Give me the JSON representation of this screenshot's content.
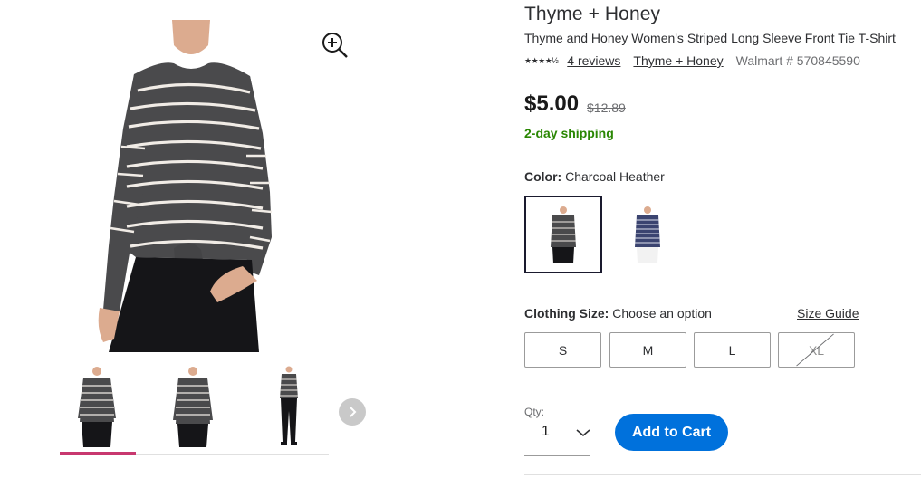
{
  "gallery": {
    "main_image_alt": "",
    "zoom_icon": "zoom-in-icon",
    "next_icon": "chevron-right-icon",
    "selected_thumbnail": 0,
    "thumbnail_count": 3
  },
  "product": {
    "brand": "Thyme + Honey",
    "title": "Thyme and Honey Women's Striped Long Sleeve Front Tie T-Shirt",
    "stars_display": "★★★★½",
    "rating": 4.5,
    "reviews_link": "4 reviews",
    "brand_link": "Thyme + Honey",
    "walmart_number": "Walmart # 570845590",
    "price": "$5.00",
    "was_price": "$12.89",
    "shipping": "2-day shipping"
  },
  "color": {
    "label": "Color:",
    "selected_value": "Charcoal Heather",
    "swatches": [
      "charcoal-heather",
      "navy-stripe"
    ]
  },
  "size": {
    "label": "Clothing Size:",
    "prompt": "Choose an option",
    "guide_link": "Size Guide",
    "options": [
      "S",
      "M",
      "L",
      "XL"
    ],
    "unavailable": [
      "XL"
    ]
  },
  "cart": {
    "qty_label": "Qty:",
    "qty_value": "1",
    "add_to_cart": "Add to Cart"
  },
  "colors": {
    "accent_blue": "#0071dc",
    "shipping_green": "#2a8703",
    "thumb_underline": "#c8386f",
    "shirt_gray": "#4a4a4c"
  }
}
